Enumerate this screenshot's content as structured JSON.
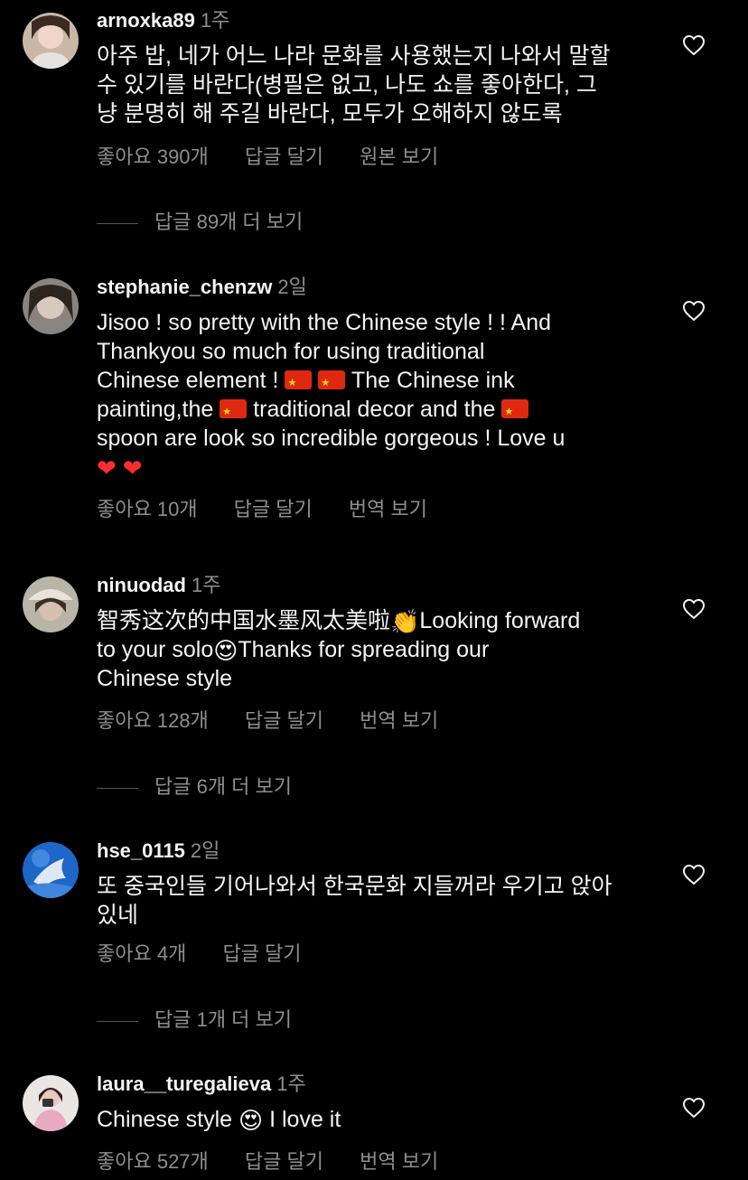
{
  "comments": [
    {
      "username": "arnoxka89",
      "time": "1주",
      "lines": [
        "아주 밥, 네가 어느 나라 문화를 사용했는지 나와서 말할",
        "수 있기를 바란다(병필은 없고, 나도 쇼를 좋아한다, 그",
        "냥 분명히 해 주길 바란다, 모두가 오해하지 않도록"
      ],
      "likes": "좋아요 390개",
      "reply": "답글 달기",
      "extra": "원본 보기",
      "more_replies": "답글 89개 더 보기"
    },
    {
      "username": "stephanie_chenzw",
      "time": "2일",
      "line1": "Jisoo ! so pretty with the Chinese style ! ! And",
      "line2": "Thankyou so much for using traditional",
      "line3a": "Chinese element !",
      "line3b": "The Chinese ink",
      "line4a": "painting,the",
      "line4b": "traditional decor and the",
      "line5": "spoon are look so incredible gorgeous ! Love u",
      "likes": "좋아요 10개",
      "reply": "답글 달기",
      "extra": "번역 보기"
    },
    {
      "username": "ninuodad",
      "time": "1주",
      "line1a": "智秀这次的中国水墨风太美啦",
      "line1b": "Looking forward",
      "line2a": "to your solo",
      "line2b": "Thanks for spreading our",
      "line3": "Chinese style",
      "likes": "좋아요 128개",
      "reply": "답글 달기",
      "extra": "번역 보기",
      "more_replies": "답글 6개 더 보기"
    },
    {
      "username": "hse_0115",
      "time": "2일",
      "lines": [
        "또 중국인들 기어나와서 한국문화 지들꺼라 우기고 앉아",
        "있네"
      ],
      "likes": "좋아요 4개",
      "reply": "답글 달기",
      "more_replies": "답글 1개 더 보기"
    },
    {
      "username": "laura__turegalieva",
      "time": "1주",
      "text_a": "Chinese style",
      "text_b": "I love it",
      "likes": "좋아요 527개",
      "reply": "답글 달기",
      "extra": "번역 보기"
    }
  ],
  "emoji": {
    "red_heart": "❤",
    "clap": "👏",
    "heart_eyes": "😍"
  },
  "colors": {
    "background": "#000000",
    "text": "#f5f5f5",
    "secondary": "#8e8e8e",
    "flag": "#de2910"
  },
  "icons": [
    "heart-outline-icon",
    "china-flag-icon"
  ]
}
